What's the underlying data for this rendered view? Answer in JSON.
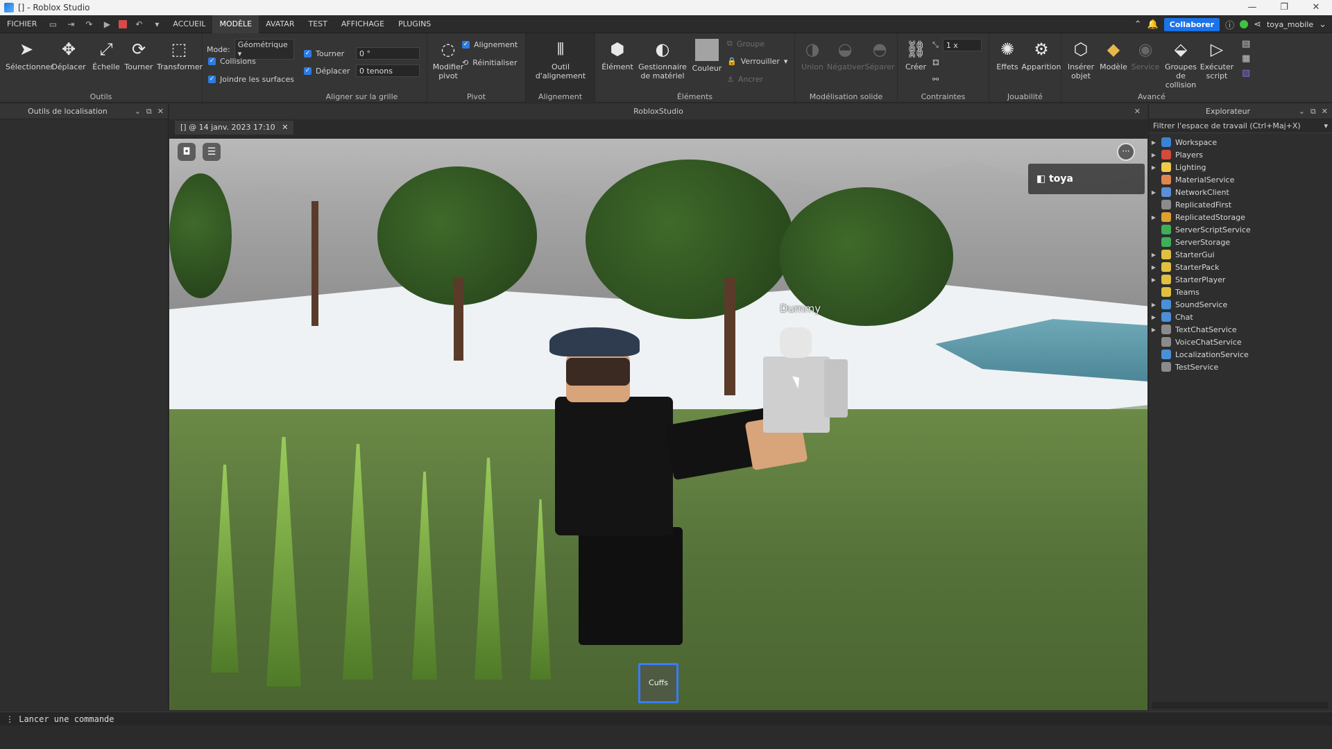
{
  "window": {
    "title": "[] - Roblox Studio",
    "controls": [
      "—",
      "❐",
      "✕"
    ]
  },
  "menu": {
    "file": "FICHIER",
    "tabs": [
      "ACCUEIL",
      "MODÈLE",
      "AVATAR",
      "TEST",
      "AFFICHAGE",
      "PLUGINS"
    ],
    "active_tab": "MODÈLE",
    "collaborate": "Collaborer",
    "user": "toya_mobile"
  },
  "ribbon": {
    "tools": {
      "select": "Sélectionner",
      "move": "Déplacer",
      "scale": "Échelle",
      "rotate": "Tourner",
      "transform": "Transformer",
      "group_label": "Outils"
    },
    "mode": {
      "label": "Mode:",
      "value": "Géométrique",
      "collisions": "Collisions",
      "join_surfaces": "Joindre les surfaces"
    },
    "grid": {
      "rotate_label": "Tourner",
      "rotate_value": "0 °",
      "move_label": "Déplacer",
      "move_value": "0 tenons",
      "group_label": "Aligner sur la grille"
    },
    "pivot": {
      "edit_pivot": "Modifier pivot",
      "alignment": "Alignement",
      "reset": "Réinitialiser",
      "group_label": "Pivot"
    },
    "align": {
      "tool": "Outil d'alignement",
      "group_label": "Alignement"
    },
    "elements": {
      "element": "Élément",
      "material_manager": "Gestionnaire de matériel",
      "color": "Couleur",
      "group": "Groupe",
      "lock": "Verrouiller",
      "anchor": "Ancrer",
      "group_label": "Éléments"
    },
    "solid": {
      "union": "Union",
      "negate": "Négativer",
      "separate": "Séparer",
      "group_label": "Modélisation solide"
    },
    "constraints": {
      "create": "Créer",
      "scale_value": "1 x",
      "group_label": "Contraintes"
    },
    "gameplay": {
      "effects": "Effets",
      "spawn": "Apparition",
      "group_label": "Jouabilité"
    },
    "advanced": {
      "insert_object": "Insérer objet",
      "model": "Modèle",
      "service": "Service",
      "collision_groups": "Groupes de collision",
      "run_script": "Exécuter script",
      "group_label": "Avancé"
    }
  },
  "left_panel": {
    "title": "Outils de localisation"
  },
  "center": {
    "title": "RobloxStudio",
    "doc_tab": "[] @ 14 janv. 2023 17:10",
    "dummy_label": "Dummy",
    "player_name": "toya",
    "hotbar_item": "Cuffs"
  },
  "explorer": {
    "title": "Explorateur",
    "filter_placeholder": "Filtrer l'espace de travail (Ctrl+Maj+X)",
    "items": [
      {
        "name": "Workspace",
        "expand": true,
        "color": "#3b82d6"
      },
      {
        "name": "Players",
        "expand": true,
        "color": "#d24b3c"
      },
      {
        "name": "Lighting",
        "expand": true,
        "color": "#f2c94c"
      },
      {
        "name": "MaterialService",
        "expand": false,
        "color": "#e0864f"
      },
      {
        "name": "NetworkClient",
        "expand": true,
        "color": "#5d8fd8"
      },
      {
        "name": "ReplicatedFirst",
        "expand": false,
        "color": "#8b8b8b"
      },
      {
        "name": "ReplicatedStorage",
        "expand": true,
        "color": "#e0a030"
      },
      {
        "name": "ServerScriptService",
        "expand": false,
        "color": "#3fae5b"
      },
      {
        "name": "ServerStorage",
        "expand": false,
        "color": "#3fae5b"
      },
      {
        "name": "StarterGui",
        "expand": true,
        "color": "#e0c040"
      },
      {
        "name": "StarterPack",
        "expand": true,
        "color": "#e0c040"
      },
      {
        "name": "StarterPlayer",
        "expand": true,
        "color": "#e0c040"
      },
      {
        "name": "Teams",
        "expand": false,
        "color": "#e0c040"
      },
      {
        "name": "SoundService",
        "expand": true,
        "color": "#4a90d9"
      },
      {
        "name": "Chat",
        "expand": true,
        "color": "#4a90d9"
      },
      {
        "name": "TextChatService",
        "expand": true,
        "color": "#8b8b8b"
      },
      {
        "name": "VoiceChatService",
        "expand": false,
        "color": "#8b8b8b"
      },
      {
        "name": "LocalizationService",
        "expand": false,
        "color": "#4a90d9"
      },
      {
        "name": "TestService",
        "expand": false,
        "color": "#8b8b8b"
      }
    ]
  },
  "command_bar": {
    "placeholder": "Lancer une commande"
  }
}
